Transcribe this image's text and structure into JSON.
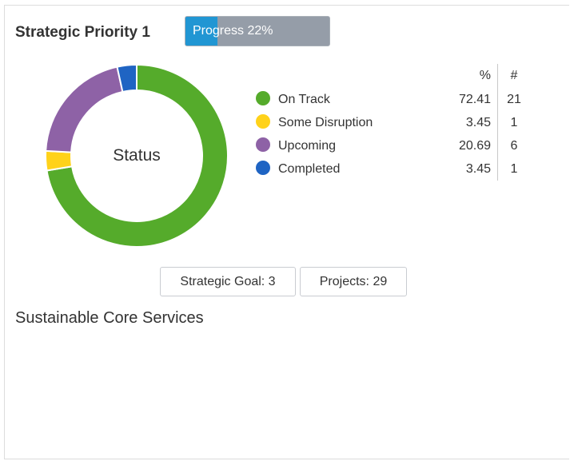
{
  "card": {
    "title": "Strategic Priority 1",
    "progress": {
      "label": "Progress 22%",
      "value": 22,
      "fill_color": "#2196d3",
      "track_color": "#959da8"
    },
    "status_chart": {
      "center_label": "Status",
      "headers": {
        "percent": "%",
        "count": "#"
      },
      "segments": [
        {
          "name": "On Track",
          "percent": "72.41",
          "count": "21",
          "value": 72.41,
          "color": "#55ab2b"
        },
        {
          "name": "Some Disruption",
          "percent": "3.45",
          "count": "1",
          "value": 3.45,
          "color": "#ffd21a"
        },
        {
          "name": "Upcoming",
          "percent": "20.69",
          "count": "6",
          "value": 20.69,
          "color": "#8e62a6"
        },
        {
          "name": "Completed",
          "percent": "3.45",
          "count": "1",
          "value": 3.45,
          "color": "#1f64c3"
        }
      ]
    },
    "buttons": {
      "strategic_goal": "Strategic Goal: 3",
      "projects": "Projects: 29"
    },
    "goal_text": "Sustainable Core Services"
  },
  "chart_data": {
    "type": "pie",
    "title": "Status",
    "categories": [
      "On Track",
      "Some Disruption",
      "Upcoming",
      "Completed"
    ],
    "values": [
      72.41,
      3.45,
      20.69,
      3.45
    ],
    "counts": [
      21,
      1,
      6,
      1
    ],
    "colors": [
      "#55ab2b",
      "#ffd21a",
      "#8e62a6",
      "#1f64c3"
    ],
    "legend": "right"
  }
}
